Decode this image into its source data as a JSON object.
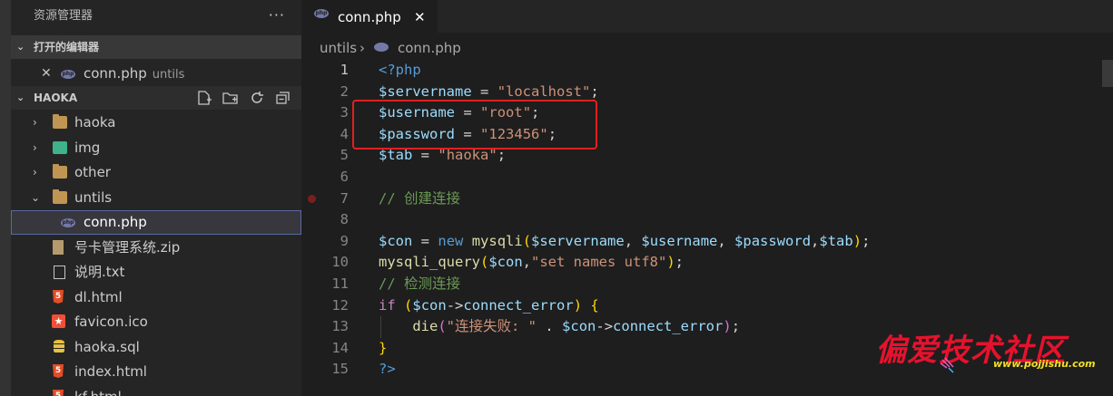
{
  "sidebar": {
    "title": "资源管理器",
    "more_label": "···",
    "open_editors_label": "打开的编辑器",
    "open_editor": {
      "close": "✕",
      "name": "conn.php",
      "desc": "untils"
    },
    "project_label": "HAOKA",
    "tree": [
      {
        "label": "haoka",
        "type": "folder",
        "expanded": false
      },
      {
        "label": "img",
        "type": "image-folder",
        "expanded": false
      },
      {
        "label": "other",
        "type": "folder",
        "expanded": false
      },
      {
        "label": "untils",
        "type": "folder-open",
        "expanded": true
      },
      {
        "label": "conn.php",
        "type": "php",
        "selected": true
      },
      {
        "label": "号卡管理系统.zip",
        "type": "zip"
      },
      {
        "label": "说明.txt",
        "type": "txt"
      },
      {
        "label": "dl.html",
        "type": "html"
      },
      {
        "label": "favicon.ico",
        "type": "favicon"
      },
      {
        "label": "haoka.sql",
        "type": "sql"
      },
      {
        "label": "index.html",
        "type": "html"
      },
      {
        "label": "kf.html",
        "type": "html"
      }
    ]
  },
  "tab": {
    "name": "conn.php",
    "close": "✕",
    "icon": "php-icon"
  },
  "breadcrumb": {
    "folder": "untils",
    "sep": "›",
    "file": "conn.php"
  },
  "code": {
    "line_numbers": [
      "1",
      "2",
      "3",
      "4",
      "5",
      "6",
      "7",
      "8",
      "9",
      "10",
      "11",
      "12",
      "13",
      "14",
      "15"
    ],
    "breakpoint_line": "7",
    "comments": {
      "create": "// 创建连接",
      "check": "// 检测连接"
    },
    "strings": {
      "servername": "\"localhost\"",
      "username": "\"root\"",
      "password": "\"123456\"",
      "tab": "\"haoka\"",
      "names": "\"set names utf8\"",
      "fail": "\"连接失败: \""
    }
  },
  "watermark": {
    "text": "偏爱技术社区",
    "url": "www.pojjishu.com"
  },
  "colors": {
    "editor_bg": "#1e1e1e",
    "sidebar_bg": "#252526",
    "highlight_box": "#e02020"
  }
}
